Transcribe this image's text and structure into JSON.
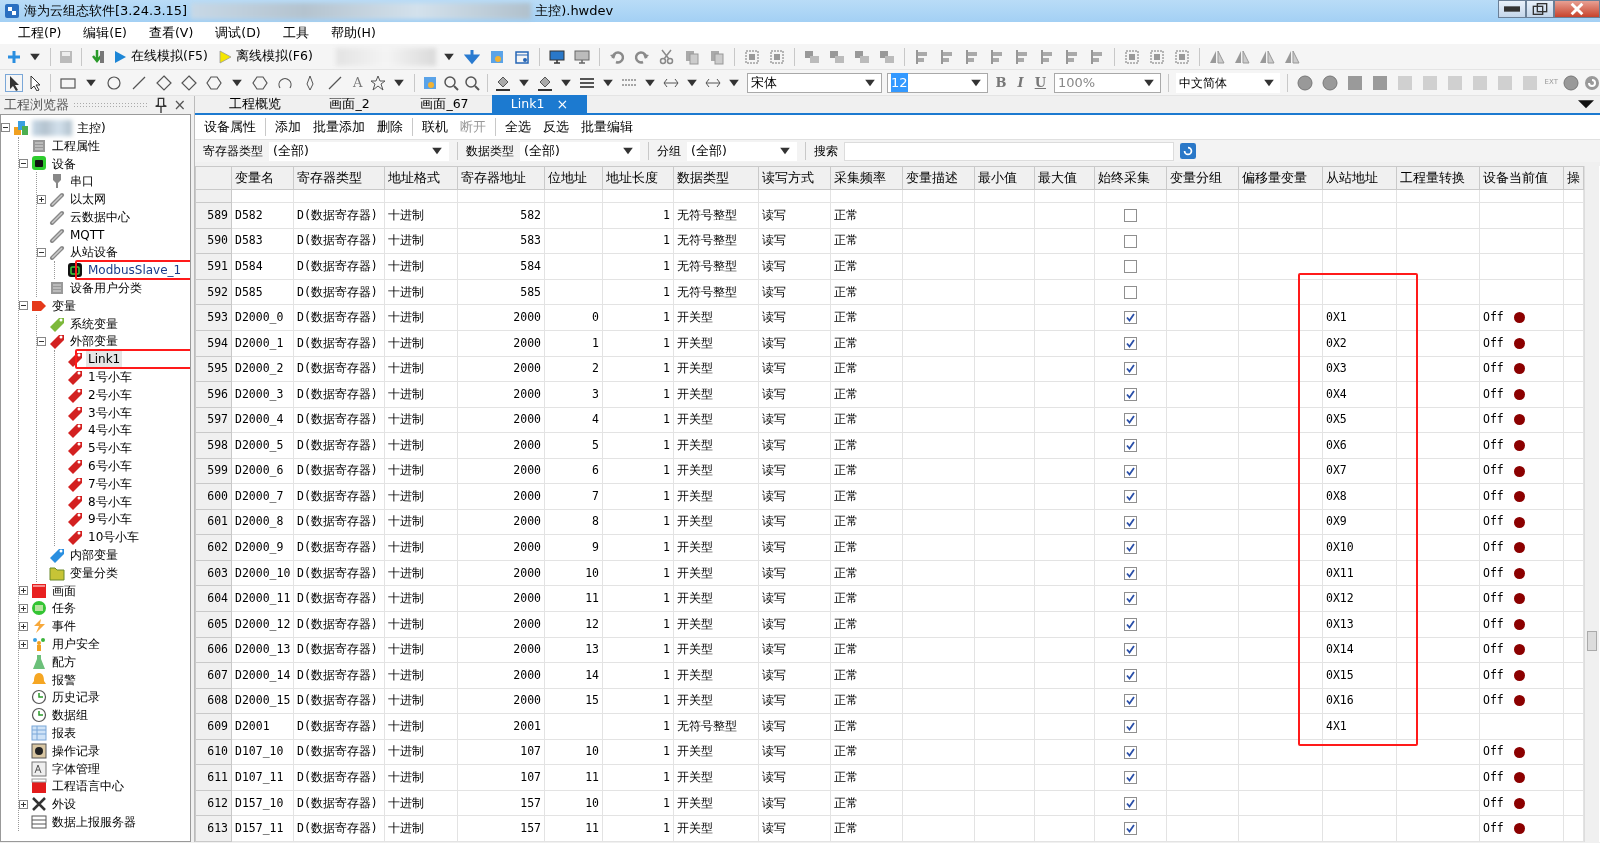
{
  "window": {
    "title": "海为云组态软件[3.24.3.15]",
    "title_tail": "主控).hwdev"
  },
  "menu": [
    "工程(P)",
    "编辑(E)",
    "查看(V)",
    "调试(D)",
    "工具",
    "帮助(H)"
  ],
  "toolbar": {
    "buttons": [
      {
        "label": "在线模拟(F5)",
        "kind": "online"
      },
      {
        "label": "离线模拟(F6)",
        "kind": "offline"
      }
    ]
  },
  "format_bar": {
    "text_tool": "A",
    "font": "宋体",
    "size": "12",
    "bold": "B",
    "italic": "I",
    "underline": "U",
    "zoom": "100%",
    "language": "中文简体",
    "ext": "EXT"
  },
  "explorer": {
    "title": "工程浏览器",
    "close": "×",
    "tree": [
      {
        "label": "主控)",
        "kind": "project",
        "expanded": true,
        "selected": false,
        "children": [
          {
            "label": "工程属性",
            "kind": "props",
            "selected": false
          },
          {
            "label": "设备",
            "kind": "device",
            "expanded": true,
            "selected": false,
            "children": [
              {
                "label": "串口",
                "kind": "plug",
                "selected": false
              },
              {
                "label": "以太网",
                "kind": "link",
                "expanded": false,
                "selected": false
              },
              {
                "label": "云数据中心",
                "kind": "link",
                "selected": false
              },
              {
                "label": "MQTT",
                "kind": "link",
                "selected": false
              },
              {
                "label": "从站设备",
                "kind": "link",
                "expanded": true,
                "selected": false,
                "children": [
                  {
                    "label": "ModbusSlave_1",
                    "kind": "slave",
                    "selected": false
                  }
                ]
              },
              {
                "label": "设备用户分类",
                "kind": "props",
                "selected": false
              }
            ]
          },
          {
            "label": "变量",
            "kind": "tagred",
            "expanded": true,
            "selected": false,
            "children": [
              {
                "label": "系统变量",
                "kind": "taggreen",
                "selected": false
              },
              {
                "label": "外部变量",
                "kind": "tag",
                "expanded": true,
                "selected": false,
                "children": [
                  {
                    "label": "Link1",
                    "kind": "tag",
                    "selected": true
                  },
                  {
                    "label": "1号小车",
                    "kind": "tag",
                    "selected": false
                  },
                  {
                    "label": "2号小车",
                    "kind": "tag",
                    "selected": false
                  },
                  {
                    "label": "3号小车",
                    "kind": "tag",
                    "selected": false
                  },
                  {
                    "label": "4号小车",
                    "kind": "tag",
                    "selected": false
                  },
                  {
                    "label": "5号小车",
                    "kind": "tag",
                    "selected": false
                  },
                  {
                    "label": "6号小车",
                    "kind": "tag",
                    "selected": false
                  },
                  {
                    "label": "7号小车",
                    "kind": "tag",
                    "selected": false
                  },
                  {
                    "label": "8号小车",
                    "kind": "tag",
                    "selected": false
                  },
                  {
                    "label": "9号小车",
                    "kind": "tag",
                    "selected": false
                  },
                  {
                    "label": "10号小车",
                    "kind": "tag",
                    "selected": false
                  }
                ]
              },
              {
                "label": "内部变量",
                "kind": "tagblue",
                "selected": false
              },
              {
                "label": "变量分类",
                "kind": "folder",
                "selected": false
              }
            ]
          },
          {
            "label": "画面",
            "kind": "screen",
            "expanded": false,
            "selected": false
          },
          {
            "label": "任务",
            "kind": "task",
            "expanded": false,
            "selected": false
          },
          {
            "label": "事件",
            "kind": "event",
            "expanded": false,
            "selected": false
          },
          {
            "label": "用户安全",
            "kind": "users",
            "expanded": false,
            "selected": false
          },
          {
            "label": "配方",
            "kind": "recipe",
            "selected": false
          },
          {
            "label": "报警",
            "kind": "bell",
            "selected": false
          },
          {
            "label": "历史记录",
            "kind": "clock",
            "selected": false
          },
          {
            "label": "数据组",
            "kind": "clock",
            "selected": false
          },
          {
            "label": "报表",
            "kind": "report",
            "selected": false
          },
          {
            "label": "操作记录",
            "kind": "record",
            "selected": false
          },
          {
            "label": "字体管理",
            "kind": "font",
            "selected": false
          },
          {
            "label": "工程语言中心",
            "kind": "lang",
            "selected": false
          },
          {
            "label": "外设",
            "kind": "tools",
            "expanded": false,
            "selected": false
          },
          {
            "label": "数据上报服务器",
            "kind": "server",
            "selected": false
          }
        ]
      }
    ]
  },
  "tabs": [
    {
      "label": "工程概览",
      "selected": false
    },
    {
      "label": "画面_2",
      "selected": false
    },
    {
      "label": "画面_67",
      "selected": false
    },
    {
      "label": "Link1",
      "selected": true,
      "close": "×"
    }
  ],
  "actions": [
    [
      {
        "label": "设备属性",
        "disabled": false
      }
    ],
    [
      {
        "label": "添加",
        "disabled": false
      },
      {
        "label": "批量添加",
        "disabled": false
      },
      {
        "label": "删除",
        "disabled": false
      }
    ],
    [
      {
        "label": "联机",
        "disabled": false
      },
      {
        "label": "断开",
        "disabled": true
      }
    ],
    [
      {
        "label": "全选",
        "disabled": false
      },
      {
        "label": "反选",
        "disabled": false
      },
      {
        "label": "批量编辑",
        "disabled": false
      }
    ]
  ],
  "filters": [
    {
      "label": "寄存器类型",
      "value": "(全部)"
    },
    {
      "label": "数据类型",
      "value": "(全部)"
    },
    {
      "label": "分组",
      "value": "(全部)"
    }
  ],
  "search": {
    "label": "搜索"
  },
  "table": {
    "columns": [
      "变量名",
      "寄存器类型",
      "地址格式",
      "寄存器地址",
      "位地址",
      "地址长度",
      "数据类型",
      "读写方式",
      "采集频率",
      "变量描述",
      "最小值",
      "最大值",
      "始终采集",
      "变量分组",
      "偏移量变量",
      "从站地址",
      "工程量转换",
      "设备当前值",
      "操"
    ],
    "rows": [
      {
        "no": "589",
        "name": "D582",
        "reg_type": "D(数据寄存器)",
        "addr_format": "十进制",
        "reg_addr": "582",
        "len": "1",
        "data_type": "无符号整型",
        "rw": "读写",
        "freq": "正常",
        "always": false
      },
      {
        "no": "590",
        "name": "D583",
        "reg_type": "D(数据寄存器)",
        "addr_format": "十进制",
        "reg_addr": "583",
        "len": "1",
        "data_type": "无符号整型",
        "rw": "读写",
        "freq": "正常",
        "always": false
      },
      {
        "no": "591",
        "name": "D584",
        "reg_type": "D(数据寄存器)",
        "addr_format": "十进制",
        "reg_addr": "584",
        "len": "1",
        "data_type": "无符号整型",
        "rw": "读写",
        "freq": "正常",
        "always": false
      },
      {
        "no": "592",
        "name": "D585",
        "reg_type": "D(数据寄存器)",
        "addr_format": "十进制",
        "reg_addr": "585",
        "len": "1",
        "data_type": "无符号整型",
        "rw": "读写",
        "freq": "正常",
        "always": false
      },
      {
        "no": "593",
        "name": "D2000_0",
        "reg_type": "D(数据寄存器)",
        "addr_format": "十进制",
        "reg_addr": "2000",
        "bit": "0",
        "len": "1",
        "data_type": "开关型",
        "rw": "读写",
        "freq": "正常",
        "always": true,
        "slave_addr": "0X1",
        "value": "Off",
        "on": false
      },
      {
        "no": "594",
        "name": "D2000_1",
        "reg_type": "D(数据寄存器)",
        "addr_format": "十进制",
        "reg_addr": "2000",
        "bit": "1",
        "len": "1",
        "data_type": "开关型",
        "rw": "读写",
        "freq": "正常",
        "always": true,
        "slave_addr": "0X2",
        "value": "Off",
        "on": false
      },
      {
        "no": "595",
        "name": "D2000_2",
        "reg_type": "D(数据寄存器)",
        "addr_format": "十进制",
        "reg_addr": "2000",
        "bit": "2",
        "len": "1",
        "data_type": "开关型",
        "rw": "读写",
        "freq": "正常",
        "always": true,
        "slave_addr": "0X3",
        "value": "Off",
        "on": false
      },
      {
        "no": "596",
        "name": "D2000_3",
        "reg_type": "D(数据寄存器)",
        "addr_format": "十进制",
        "reg_addr": "2000",
        "bit": "3",
        "len": "1",
        "data_type": "开关型",
        "rw": "读写",
        "freq": "正常",
        "always": true,
        "slave_addr": "0X4",
        "value": "Off",
        "on": false
      },
      {
        "no": "597",
        "name": "D2000_4",
        "reg_type": "D(数据寄存器)",
        "addr_format": "十进制",
        "reg_addr": "2000",
        "bit": "4",
        "len": "1",
        "data_type": "开关型",
        "rw": "读写",
        "freq": "正常",
        "always": true,
        "slave_addr": "0X5",
        "value": "Off",
        "on": false
      },
      {
        "no": "598",
        "name": "D2000_5",
        "reg_type": "D(数据寄存器)",
        "addr_format": "十进制",
        "reg_addr": "2000",
        "bit": "5",
        "len": "1",
        "data_type": "开关型",
        "rw": "读写",
        "freq": "正常",
        "always": true,
        "slave_addr": "0X6",
        "value": "Off",
        "on": false
      },
      {
        "no": "599",
        "name": "D2000_6",
        "reg_type": "D(数据寄存器)",
        "addr_format": "十进制",
        "reg_addr": "2000",
        "bit": "6",
        "len": "1",
        "data_type": "开关型",
        "rw": "读写",
        "freq": "正常",
        "always": true,
        "slave_addr": "0X7",
        "value": "Off",
        "on": false
      },
      {
        "no": "600",
        "name": "D2000_7",
        "reg_type": "D(数据寄存器)",
        "addr_format": "十进制",
        "reg_addr": "2000",
        "bit": "7",
        "len": "1",
        "data_type": "开关型",
        "rw": "读写",
        "freq": "正常",
        "always": true,
        "slave_addr": "0X8",
        "value": "Off",
        "on": false
      },
      {
        "no": "601",
        "name": "D2000_8",
        "reg_type": "D(数据寄存器)",
        "addr_format": "十进制",
        "reg_addr": "2000",
        "bit": "8",
        "len": "1",
        "data_type": "开关型",
        "rw": "读写",
        "freq": "正常",
        "always": true,
        "slave_addr": "0X9",
        "value": "Off",
        "on": false
      },
      {
        "no": "602",
        "name": "D2000_9",
        "reg_type": "D(数据寄存器)",
        "addr_format": "十进制",
        "reg_addr": "2000",
        "bit": "9",
        "len": "1",
        "data_type": "开关型",
        "rw": "读写",
        "freq": "正常",
        "always": true,
        "slave_addr": "0X10",
        "value": "Off",
        "on": false
      },
      {
        "no": "603",
        "name": "D2000_10",
        "reg_type": "D(数据寄存器)",
        "addr_format": "十进制",
        "reg_addr": "2000",
        "bit": "10",
        "len": "1",
        "data_type": "开关型",
        "rw": "读写",
        "freq": "正常",
        "always": true,
        "slave_addr": "0X11",
        "value": "Off",
        "on": false
      },
      {
        "no": "604",
        "name": "D2000_11",
        "reg_type": "D(数据寄存器)",
        "addr_format": "十进制",
        "reg_addr": "2000",
        "bit": "11",
        "len": "1",
        "data_type": "开关型",
        "rw": "读写",
        "freq": "正常",
        "always": true,
        "slave_addr": "0X12",
        "value": "Off",
        "on": false
      },
      {
        "no": "605",
        "name": "D2000_12",
        "reg_type": "D(数据寄存器)",
        "addr_format": "十进制",
        "reg_addr": "2000",
        "bit": "12",
        "len": "1",
        "data_type": "开关型",
        "rw": "读写",
        "freq": "正常",
        "always": true,
        "slave_addr": "0X13",
        "value": "Off",
        "on": false
      },
      {
        "no": "606",
        "name": "D2000_13",
        "reg_type": "D(数据寄存器)",
        "addr_format": "十进制",
        "reg_addr": "2000",
        "bit": "13",
        "len": "1",
        "data_type": "开关型",
        "rw": "读写",
        "freq": "正常",
        "always": true,
        "slave_addr": "0X14",
        "value": "Off",
        "on": false
      },
      {
        "no": "607",
        "name": "D2000_14",
        "reg_type": "D(数据寄存器)",
        "addr_format": "十进制",
        "reg_addr": "2000",
        "bit": "14",
        "len": "1",
        "data_type": "开关型",
        "rw": "读写",
        "freq": "正常",
        "always": true,
        "slave_addr": "0X15",
        "value": "Off",
        "on": false
      },
      {
        "no": "608",
        "name": "D2000_15",
        "reg_type": "D(数据寄存器)",
        "addr_format": "十进制",
        "reg_addr": "2000",
        "bit": "15",
        "len": "1",
        "data_type": "开关型",
        "rw": "读写",
        "freq": "正常",
        "always": true,
        "slave_addr": "0X16",
        "value": "Off",
        "on": false
      },
      {
        "no": "609",
        "name": "D2001",
        "reg_type": "D(数据寄存器)",
        "addr_format": "十进制",
        "reg_addr": "2001",
        "len": "1",
        "data_type": "无符号整型",
        "rw": "读写",
        "freq": "正常",
        "always": true,
        "slave_addr": "4X1"
      },
      {
        "no": "610",
        "name": "D107_10",
        "reg_type": "D(数据寄存器)",
        "addr_format": "十进制",
        "reg_addr": "107",
        "bit": "10",
        "len": "1",
        "data_type": "开关型",
        "rw": "读写",
        "freq": "正常",
        "always": true,
        "value": "Off",
        "on": false
      },
      {
        "no": "611",
        "name": "D107_11",
        "reg_type": "D(数据寄存器)",
        "addr_format": "十进制",
        "reg_addr": "107",
        "bit": "11",
        "len": "1",
        "data_type": "开关型",
        "rw": "读写",
        "freq": "正常",
        "always": true,
        "value": "Off",
        "on": false
      },
      {
        "no": "612",
        "name": "D157_10",
        "reg_type": "D(数据寄存器)",
        "addr_format": "十进制",
        "reg_addr": "157",
        "bit": "10",
        "len": "1",
        "data_type": "开关型",
        "rw": "读写",
        "freq": "正常",
        "always": true,
        "value": "Off",
        "on": false
      },
      {
        "no": "613",
        "name": "D157_11",
        "reg_type": "D(数据寄存器)",
        "addr_format": "十进制",
        "reg_addr": "157",
        "bit": "11",
        "len": "1",
        "data_type": "开关型",
        "rw": "读写",
        "freq": "正常",
        "always": true,
        "value": "Off",
        "on": false
      }
    ]
  }
}
